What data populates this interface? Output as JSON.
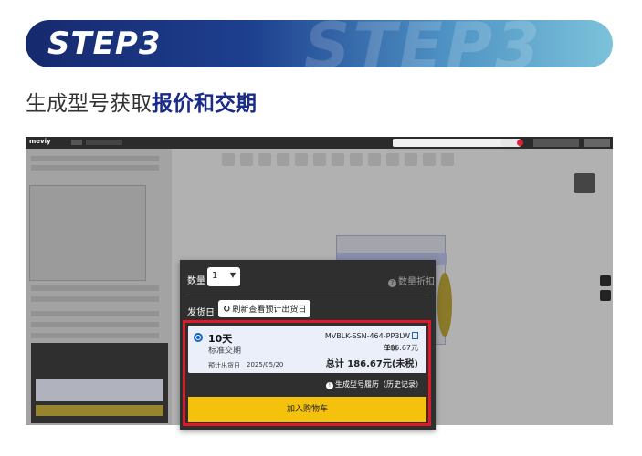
{
  "banner": {
    "bg_text": "STEP3",
    "label": "STEP3"
  },
  "headline": {
    "normal": "生成型号获取",
    "bold": "报价和交期"
  },
  "app": {
    "logo": "meviy"
  },
  "quote": {
    "qty_label": "数量",
    "qty_value": "1",
    "qty_help": "数量折扣",
    "ship_label": "发货日",
    "refresh_label": "刷新查看预计出货日",
    "option": {
      "days": "10天",
      "type": "标准交期",
      "date_label": "预计出货日",
      "date_value": "2025/05/20",
      "part_number": "MVBLK-SSN-464-PP3LW",
      "unit_label": "单价",
      "unit_price": "186.67元",
      "total": "总计 186.67元(未税)"
    },
    "history": "生成型号履历（历史记录）",
    "cart": "加入购物车"
  },
  "colors": {
    "accent": "#1a2b8a",
    "alert": "#e0192a",
    "cart": "#f4c20d"
  }
}
